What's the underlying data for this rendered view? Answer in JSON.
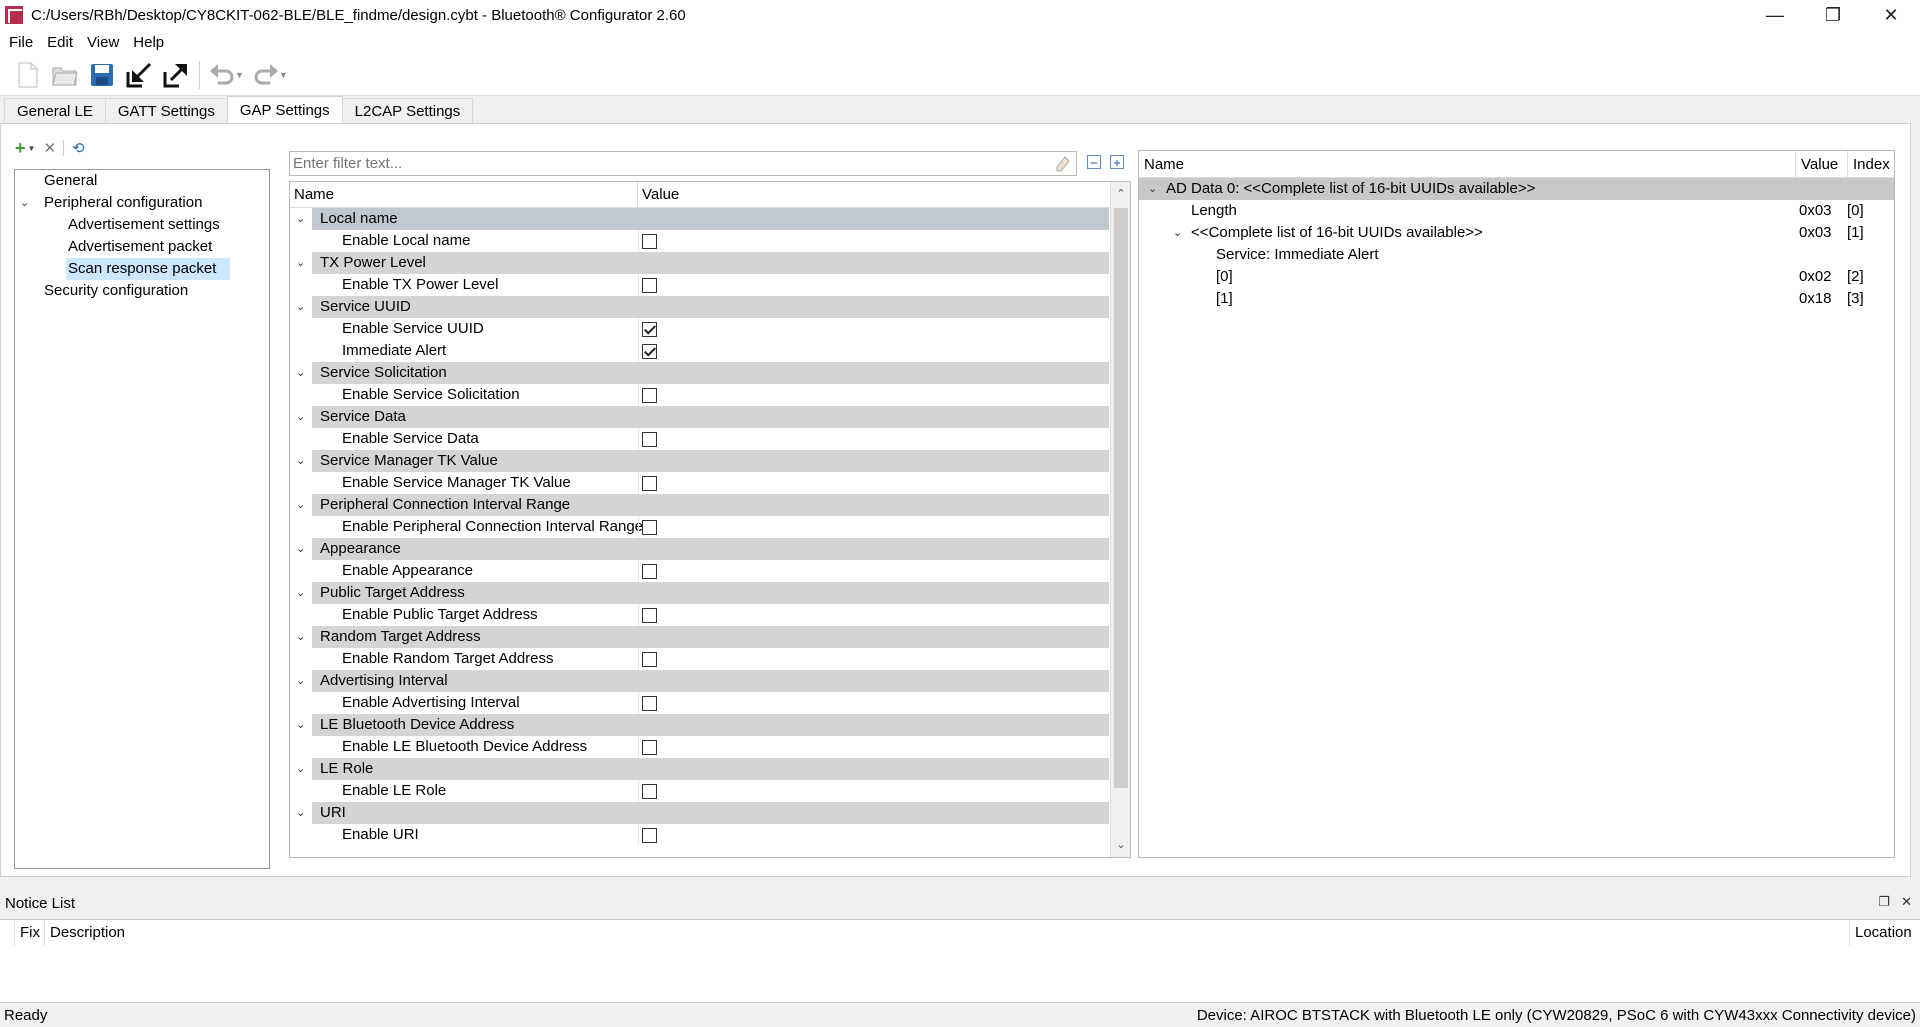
{
  "window": {
    "title": "C:/Users/RBh/Desktop/CY8CKIT-062-BLE/BLE_findme/design.cybt - Bluetooth® Configurator 2.60",
    "minimize": "—",
    "restore": "❐",
    "close": "✕"
  },
  "menu": [
    "File",
    "Edit",
    "View",
    "Help"
  ],
  "toolbar": {
    "icons": [
      "new-file-icon",
      "open-folder-icon",
      "save-icon",
      "import-icon",
      "export-icon",
      "undo-icon",
      "redo-icon"
    ]
  },
  "tabs": [
    {
      "label": "General LE",
      "active": false
    },
    {
      "label": "GATT Settings",
      "active": false
    },
    {
      "label": "GAP Settings",
      "active": true
    },
    {
      "label": "L2CAP Settings",
      "active": false
    }
  ],
  "nav": {
    "items": [
      {
        "label": "General",
        "level": 0,
        "expandable": false
      },
      {
        "label": "Peripheral configuration",
        "level": 0,
        "expandable": true
      },
      {
        "label": "Advertisement settings",
        "level": 1,
        "expandable": false
      },
      {
        "label": "Advertisement packet",
        "level": 1,
        "expandable": false
      },
      {
        "label": "Scan response packet",
        "level": 1,
        "expandable": false,
        "selected": true
      },
      {
        "label": "Security configuration",
        "level": 0,
        "expandable": false
      }
    ]
  },
  "filter": {
    "placeholder": "Enter filter text..."
  },
  "grid": {
    "header_name": "Name",
    "header_value": "Value",
    "groups": [
      {
        "label": "Local name",
        "items": [
          {
            "label": "Enable Local name",
            "checked": false
          }
        ]
      },
      {
        "label": "TX Power Level",
        "items": [
          {
            "label": "Enable TX Power Level",
            "checked": false
          }
        ]
      },
      {
        "label": "Service UUID",
        "items": [
          {
            "label": "Enable Service UUID",
            "checked": true
          },
          {
            "label": "Immediate Alert",
            "checked": true
          }
        ]
      },
      {
        "label": "Service Solicitation",
        "items": [
          {
            "label": "Enable Service Solicitation",
            "checked": false
          }
        ]
      },
      {
        "label": "Service Data",
        "items": [
          {
            "label": "Enable Service Data",
            "checked": false
          }
        ]
      },
      {
        "label": "Service Manager TK Value",
        "items": [
          {
            "label": "Enable Service Manager TK Value",
            "checked": false
          }
        ]
      },
      {
        "label": "Peripheral Connection Interval Range",
        "items": [
          {
            "label": "Enable Peripheral Connection Interval Range",
            "checked": false
          }
        ]
      },
      {
        "label": "Appearance",
        "items": [
          {
            "label": "Enable Appearance",
            "checked": false
          }
        ]
      },
      {
        "label": "Public Target Address",
        "items": [
          {
            "label": "Enable Public Target Address",
            "checked": false
          }
        ]
      },
      {
        "label": "Random Target Address",
        "items": [
          {
            "label": "Enable Random Target Address",
            "checked": false
          }
        ]
      },
      {
        "label": "Advertising Interval",
        "items": [
          {
            "label": "Enable Advertising Interval",
            "checked": false
          }
        ]
      },
      {
        "label": "LE Bluetooth Device Address",
        "items": [
          {
            "label": "Enable LE Bluetooth Device Address",
            "checked": false
          }
        ]
      },
      {
        "label": "LE Role",
        "items": [
          {
            "label": "Enable LE Role",
            "checked": false
          }
        ]
      },
      {
        "label": "URI",
        "items": [
          {
            "label": "Enable URI",
            "checked": false
          }
        ]
      }
    ]
  },
  "ad_data": {
    "header_name": "Name",
    "header_value": "Value",
    "header_index": "Index",
    "rows": [
      {
        "name": "AD Data 0: <<Complete list of 16-bit UUIDs available>>",
        "value": "",
        "index": "",
        "level": 0,
        "expandable": true,
        "top": true
      },
      {
        "name": "Length",
        "value": "0x03",
        "index": "[0]",
        "level": 1,
        "expandable": false
      },
      {
        "name": "<<Complete list of 16-bit UUIDs available>>",
        "value": "0x03",
        "index": "[1]",
        "level": 1,
        "expandable": true
      },
      {
        "name": "Service: Immediate Alert",
        "value": "",
        "index": "",
        "level": 2,
        "expandable": false
      },
      {
        "name": "[0]",
        "value": "0x02",
        "index": "[2]",
        "level": 2,
        "expandable": false
      },
      {
        "name": "[1]",
        "value": "0x18",
        "index": "[3]",
        "level": 2,
        "expandable": false
      }
    ]
  },
  "notice": {
    "title": "Notice List",
    "col_fix": "Fix",
    "col_description": "Description",
    "col_location": "Location"
  },
  "status": {
    "left": "Ready",
    "right": "Device: AIROC BTSTACK with Bluetooth LE only (CYW20829, PSoC 6 with CYW43xxx Connectivity device)"
  }
}
